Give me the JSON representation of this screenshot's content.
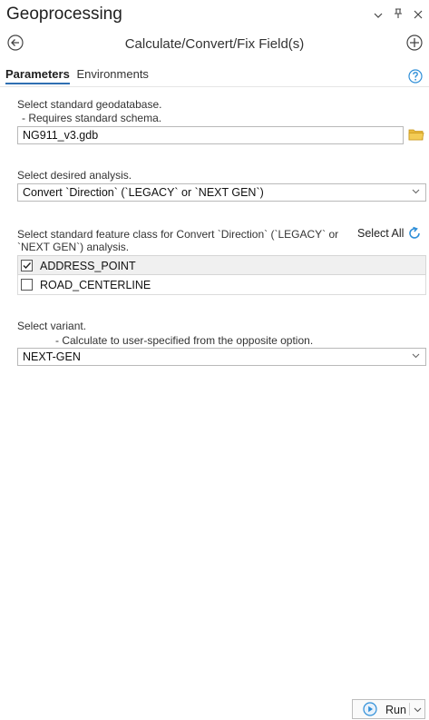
{
  "window": {
    "title": "Geoprocessing",
    "icons": [
      "chevron-down-icon",
      "pin-icon",
      "close-icon"
    ]
  },
  "tool": {
    "title": "Calculate/Convert/Fix Field(s)"
  },
  "tabs": [
    {
      "label": "Parameters",
      "active": true
    },
    {
      "label": "Environments",
      "active": false
    }
  ],
  "params": {
    "gdb": {
      "label": "Select standard geodatabase.",
      "sublabel": "- Requires standard schema.",
      "value": "NG911_v3.gdb"
    },
    "analysis": {
      "label": "Select desired analysis.",
      "value": "Convert `Direction` (`LEGACY` or `NEXT GEN`)"
    },
    "feature_class": {
      "label_line1": "Select standard feature class for Convert `Direction` (`LEGACY` or",
      "label_line2": "`NEXT GEN`) analysis.",
      "select_all": "Select All",
      "items": [
        {
          "label": "ADDRESS_POINT",
          "checked": true
        },
        {
          "label": "ROAD_CENTERLINE",
          "checked": false
        }
      ]
    },
    "variant": {
      "label": "Select variant.",
      "sublabel": "- Calculate to user-specified from the opposite option.",
      "value": "NEXT-GEN"
    }
  },
  "footer": {
    "run_label": "Run"
  },
  "colors": {
    "accent": "#2f6fb2",
    "folder": "#e8b93b"
  }
}
